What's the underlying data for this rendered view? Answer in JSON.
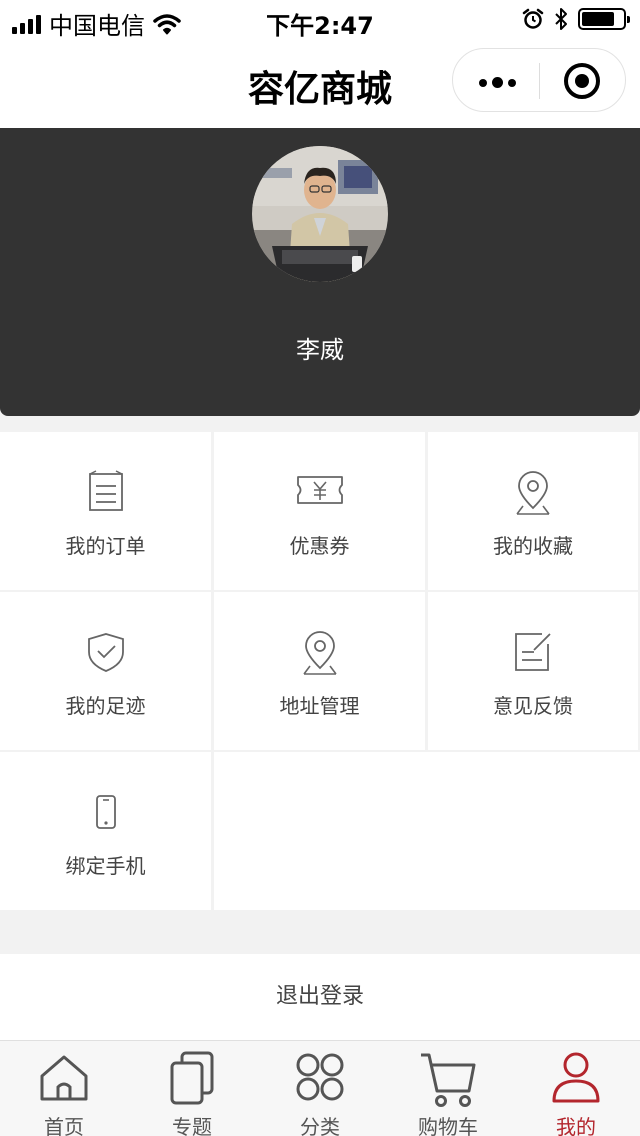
{
  "status_bar": {
    "carrier": "中国电信",
    "time": "下午2:47",
    "battery_level": 0.8
  },
  "nav": {
    "title": "容亿商城",
    "menu_icon": "more-dots-icon",
    "close_icon": "target-close-icon"
  },
  "profile": {
    "username": "李威",
    "background_color": "#333333"
  },
  "menu": [
    {
      "label": "我的订单",
      "icon": "order-list-icon"
    },
    {
      "label": "优惠券",
      "icon": "coupon-icon"
    },
    {
      "label": "我的收藏",
      "icon": "favorite-pin-icon"
    },
    {
      "label": "我的足迹",
      "icon": "shield-check-icon"
    },
    {
      "label": "地址管理",
      "icon": "location-pin-icon"
    },
    {
      "label": "意见反馈",
      "icon": "feedback-edit-icon"
    },
    {
      "label": "绑定手机",
      "icon": "phone-icon"
    }
  ],
  "logout_label": "退出登录",
  "tabbar": {
    "active_color": "#b3262d",
    "items": [
      {
        "label": "首页",
        "icon": "home-icon",
        "active": false
      },
      {
        "label": "专题",
        "icon": "topic-cards-icon",
        "active": false
      },
      {
        "label": "分类",
        "icon": "category-circles-icon",
        "active": false
      },
      {
        "label": "购物车",
        "icon": "cart-icon",
        "active": false
      },
      {
        "label": "我的",
        "icon": "user-icon",
        "active": true
      }
    ]
  }
}
